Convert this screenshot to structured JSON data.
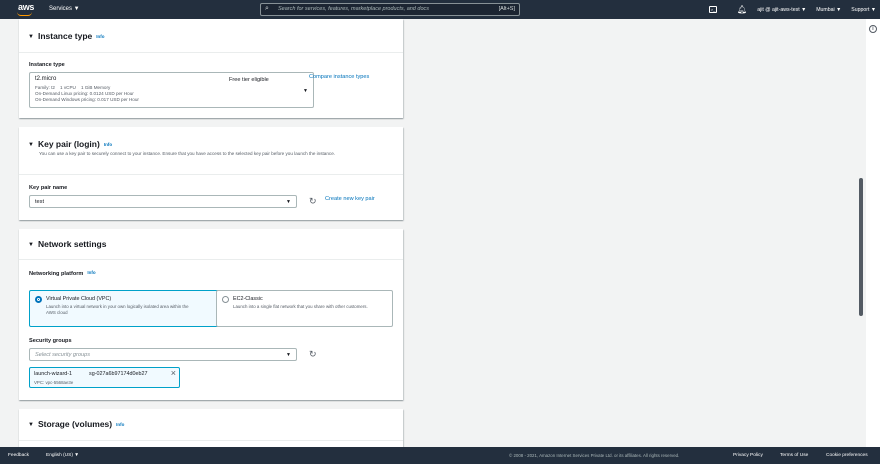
{
  "nav": {
    "logo": "aws",
    "services": "Services ▼",
    "search_placeholder": "Search for services, features, marketplace products, and docs",
    "search_shortcut": "[Alt+S]",
    "user": "ajit @ ajit-aws-test ▼",
    "region": "Mumbai ▼",
    "support": "Support ▼"
  },
  "instance_type": {
    "title": "Instance type",
    "info": "Info",
    "label": "Instance type",
    "selected": "t2.micro",
    "free_tier": "Free tier eligible",
    "details": [
      "Family: t2    1 vCPU    1 GiB Memory",
      "On-Demand Linux pricing: 0.0124 USD per Hour",
      "On-Demand Windows pricing: 0.017 USD per Hour"
    ],
    "compare_link": "Compare instance types"
  },
  "key_pair": {
    "title": "Key pair (login)",
    "info": "Info",
    "description": "You can use a key pair to securely connect to your instance. Ensure that you have access to the selected key pair before you launch the instance.",
    "label": "Key pair name",
    "selected": "test",
    "create_link": "Create new key pair"
  },
  "network": {
    "title": "Network settings",
    "platform_label": "Networking platform",
    "info": "Info",
    "options": [
      {
        "title": "Virtual Private Cloud (VPC)",
        "desc": "Launch into a virtual network in your own logically isolated area within the AWS cloud",
        "selected": true
      },
      {
        "title": "EC2-Classic",
        "desc": "Launch into a single flat network that you share with other customers.",
        "selected": false
      }
    ],
    "sg_label": "Security groups",
    "sg_placeholder": "Select security groups",
    "token_name": "launch-wizard-1",
    "token_id": "sg-027a6b97174d0eb27",
    "token_vpc": "VPC: vpc-5568ae3e"
  },
  "storage": {
    "title": "Storage (volumes)",
    "info": "Info"
  },
  "footer": {
    "feedback": "Feedback",
    "language": "English (US) ▼",
    "copyright": "© 2008 - 2021, Amazon Internet Services Private Ltd. or its affiliates. All rights reserved.",
    "privacy": "Privacy Policy",
    "terms": "Terms of Use",
    "cookies": "Cookie preferences"
  }
}
